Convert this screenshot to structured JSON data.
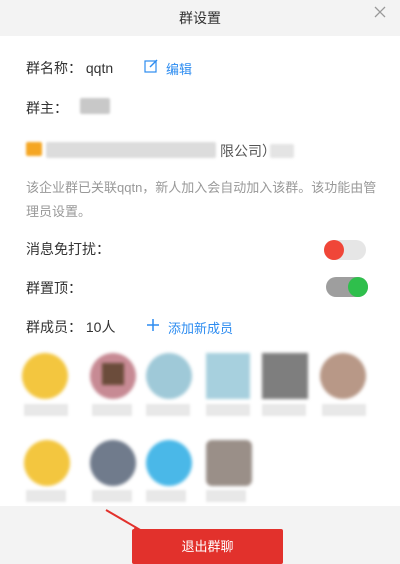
{
  "window": {
    "title": "群设置",
    "close_icon": "close-icon"
  },
  "group_name": {
    "label": "群名称：",
    "value": "qqtn",
    "edit_label": "编辑"
  },
  "owner": {
    "label": "群主："
  },
  "company": {
    "suffix": "限公司）"
  },
  "description": "该企业群已关联qqtn，新人加入会自动加入该群。该功能由管理员设置。",
  "mute": {
    "label": "消息免打扰：",
    "enabled": false
  },
  "pin": {
    "label": "群置顶：",
    "enabled": true
  },
  "members": {
    "label": "群成员：",
    "count": "10人",
    "add_label": "添加新成员"
  },
  "footer": {
    "exit_label": "退出群聊"
  },
  "colors": {
    "accent": "#2d8cf0",
    "danger": "#e2312c",
    "toggle_on": "#2fbf4c",
    "toggle_off": "#f04638"
  }
}
